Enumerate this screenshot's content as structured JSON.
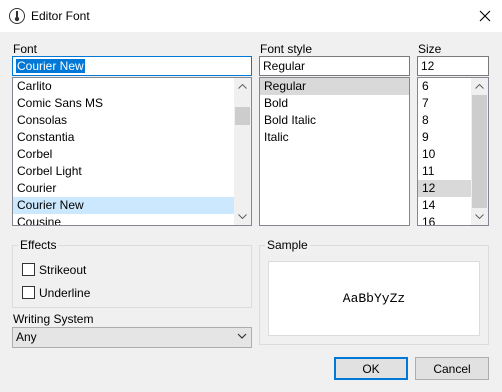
{
  "window": {
    "title": "Editor Font",
    "app_icon": "thermometer-icon",
    "close_icon": "close-icon"
  },
  "font": {
    "label": "Font",
    "value": "Courier New",
    "items": [
      "Carlito",
      "Comic Sans MS",
      "Consolas",
      "Constantia",
      "Corbel",
      "Corbel Light",
      "Courier",
      "Courier New",
      "Cousine"
    ],
    "selected": "Courier New"
  },
  "font_style": {
    "label": "Font style",
    "value": "Regular",
    "items": [
      "Regular",
      "Bold",
      "Bold Italic",
      "Italic"
    ],
    "selected": "Regular"
  },
  "size": {
    "label": "Size",
    "value": "12",
    "items": [
      "6",
      "7",
      "8",
      "9",
      "10",
      "11",
      "12",
      "14",
      "16"
    ],
    "selected": "12"
  },
  "effects": {
    "title": "Effects",
    "strikeout_label": "Strikeout",
    "underline_label": "Underline",
    "strikeout_checked": false,
    "underline_checked": false
  },
  "sample": {
    "title": "Sample",
    "text": "AaBbYyZz"
  },
  "writing_system": {
    "label": "Writing System",
    "value": "Any"
  },
  "buttons": {
    "ok": "OK",
    "cancel": "Cancel"
  },
  "colors": {
    "accent": "#0078d7",
    "list_selection": "#cce8ff"
  }
}
